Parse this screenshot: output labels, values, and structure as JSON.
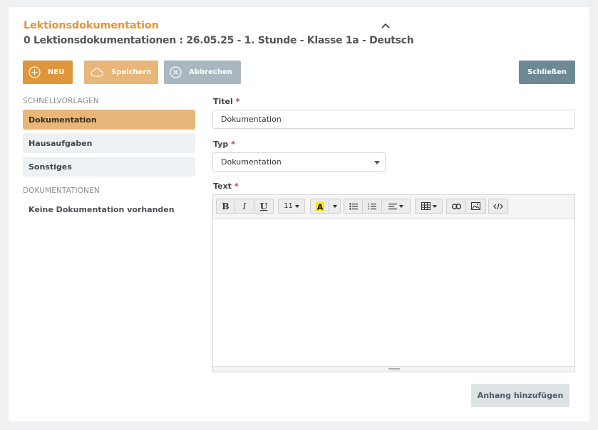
{
  "header": {
    "title": "Lektionsdokumentation",
    "subtitle": "0 Lektionsdokumentationen : 26.05.25 - 1. Stunde - Klasse 1a - Deutsch"
  },
  "actions": {
    "new_label": "NEU",
    "save_label": "Speichern",
    "cancel_label": "Abbrechen",
    "close_label": "Schließen"
  },
  "sidebar": {
    "templates_heading": "SCHNELLVORLAGEN",
    "templates": [
      {
        "label": "Dokumentation",
        "active": true
      },
      {
        "label": "Hausaufgaben",
        "active": false
      },
      {
        "label": "Sonstiges",
        "active": false
      }
    ],
    "docs_heading": "DOKUMENTATIONEN",
    "docs_empty": "Keine Dokumentation vorhanden"
  },
  "form": {
    "title_label": "Titel",
    "title_value": "Dokumentation",
    "type_label": "Typ",
    "type_value": "Dokumentation",
    "text_label": "Text",
    "required_marker": "*",
    "font_size": "11",
    "attach_label": "Anhang hinzufügen"
  },
  "toolbar_icons": [
    "bold-icon",
    "italic-icon",
    "underline-icon",
    "font-size-dropdown",
    "text-color-icon",
    "bullet-list-icon",
    "numbered-list-icon",
    "align-icon",
    "table-icon",
    "link-icon",
    "image-icon",
    "code-view-icon"
  ],
  "colors": {
    "accent": "#e0963a",
    "accent_light": "#e8b678",
    "cancel": "#a9b8c0",
    "close": "#6d8993",
    "required": "#d9342b"
  }
}
